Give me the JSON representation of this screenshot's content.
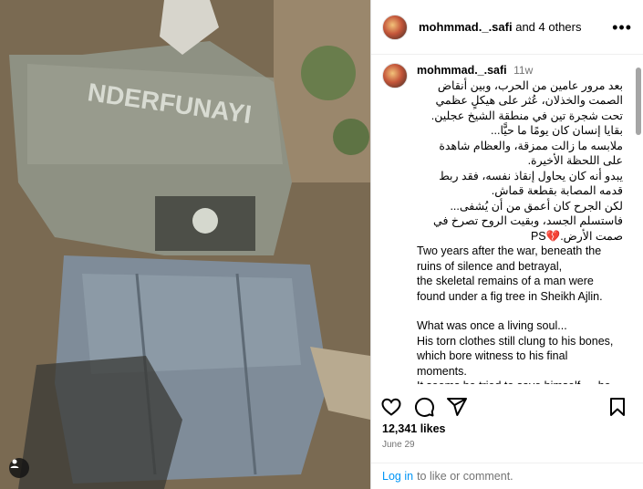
{
  "post": {
    "header": {
      "username": "mohmmad._.safi",
      "coauthors": "and 4 others",
      "more_icon": "more-horizontal-icon"
    },
    "caption": {
      "username": "mohmmad._.safi",
      "time": "11w",
      "arabic_lines": [
        "بعد مرور عامين من الحرب، وبين أنقاض",
        "الصمت والخذلان، عُثر على هيكلٍ عظمي",
        "تحت شجرة تين في منطقة الشيخ عجلين.",
        "بقايا إنسان كان يومًا ما حيًّا...",
        "ملابسه ما زالت ممزقة، والعظام شاهدة",
        "على اللحظة الأخيرة.",
        "يبدو أنه كان يحاول إنقاذ نفسه، فقد ربط",
        "قدمه المصابة بقطعة قماش.",
        "لكن الجرح كان أعمق من أن يُشفى...",
        "فاستسلم الجسد، وبقيت الروح تصرخ في",
        "صمت الأرض.💔PS"
      ],
      "english_paragraphs": [
        [
          "Two years after the war, beneath the",
          "ruins of silence and betrayal,",
          "the skeletal remains of a man were",
          "found under a fig tree in Sheikh Ajlin."
        ],
        [
          "What was once a living soul...",
          "His torn clothes still clung to his bones,",
          "which bore witness to his final",
          "moments.",
          "It seems he tried to save himself — he"
        ]
      ]
    },
    "likes": "12,341 likes",
    "date": "June 29",
    "login_prompt": {
      "link": "Log in",
      "text": "to like or comment."
    }
  },
  "icons": [
    "like-heart-icon",
    "comment-icon",
    "share-icon",
    "save-bookmark-icon",
    "user-tag-icon"
  ]
}
